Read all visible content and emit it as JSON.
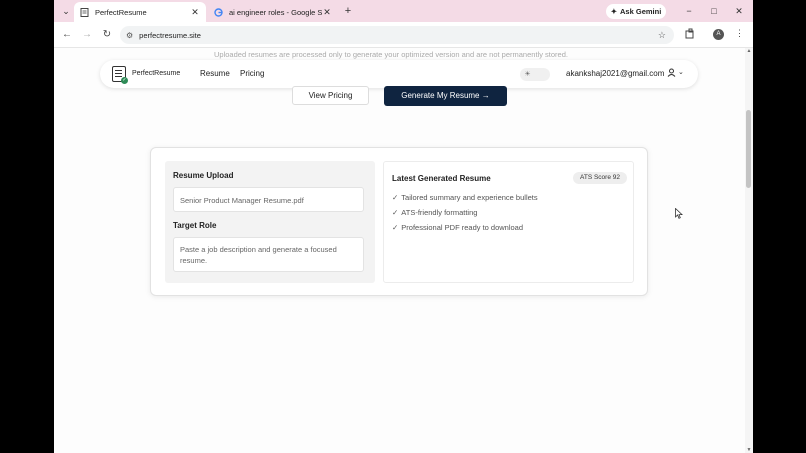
{
  "browser": {
    "tabs": [
      {
        "title": "PerfectResume",
        "active": true,
        "favicon": "document-icon"
      },
      {
        "title": "ai engineer roles - Google Sear",
        "active": false,
        "favicon": "google-icon"
      }
    ],
    "new_tab": "+",
    "gemini_label": "Ask Gemini",
    "window_controls": {
      "minimize": "−",
      "maximize": "□",
      "close": "✕"
    },
    "url": "perfectresume.site",
    "profile_initial": "A",
    "accent": "#f4dbe6"
  },
  "page": {
    "notice": "Uploaded resumes are processed only to generate your optimized version and are not permanently stored.",
    "nav": {
      "brand": "PerfectResume",
      "links": [
        "Resume",
        "Pricing"
      ],
      "email": "akankshaj2021@gmail.com"
    },
    "cta": {
      "pricing_label": "View Pricing",
      "generate_label": "Generate My Resume →",
      "generate_color": "#0f2440"
    },
    "upload": {
      "heading": "Resume Upload",
      "file_value": "Senior Product Manager Resume.pdf",
      "role_heading": "Target Role",
      "role_placeholder": "Paste a job description and generate a focused resume."
    },
    "result": {
      "heading": "Latest Generated Resume",
      "ats_badge": "ATS Score 92",
      "bullets": [
        "Tailored summary and experience bullets",
        "ATS-friendly formatting",
        "Professional PDF ready to download"
      ]
    }
  }
}
